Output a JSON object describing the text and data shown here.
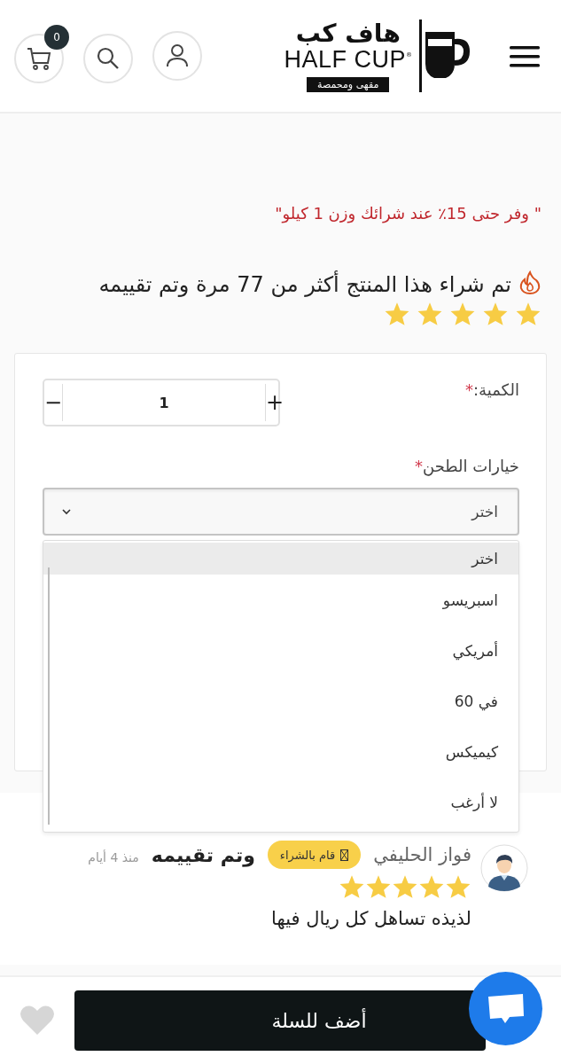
{
  "header": {
    "logo": {
      "arabic_name": "هاف كب",
      "name": "HALF CUP",
      "registered": "®",
      "tagline": "مقهى ومحمصة"
    },
    "cart_count": "0"
  },
  "promo": "\" وفر حتى 15٪ عند شرائك وزن 1 كيلو\"",
  "popularity": {
    "text": "تم شراء هذا المنتج أكثر من 77 مرة وتم تقييمه",
    "stars": 5
  },
  "options": {
    "quantity": {
      "label": "الكمية:",
      "required_mark": "*",
      "value": "1",
      "decrement": "−",
      "increment": "+"
    },
    "grind": {
      "label": "خيارات الطحن",
      "required_mark": "*",
      "value": "اختر",
      "expanded": true,
      "options": [
        {
          "label": "اختر",
          "selected": true
        },
        {
          "label": "اسبريسو",
          "selected": false
        },
        {
          "label": "أمريكي",
          "selected": false
        },
        {
          "label": "في 60",
          "selected": false
        },
        {
          "label": "كيميكس",
          "selected": false
        },
        {
          "label": "لا أرغب",
          "selected": false
        }
      ]
    }
  },
  "review": {
    "name": "فواز الحليفي",
    "badge": "قام بالشراء",
    "rated_text": "وتم تقييمه",
    "time": "منذ 4 أيام",
    "stars": 5,
    "comment": "لذيذه تساهل كل ريال فيها"
  },
  "bottom_bar": {
    "add_to_cart": "أضف للسلة",
    "favorite": false
  }
}
